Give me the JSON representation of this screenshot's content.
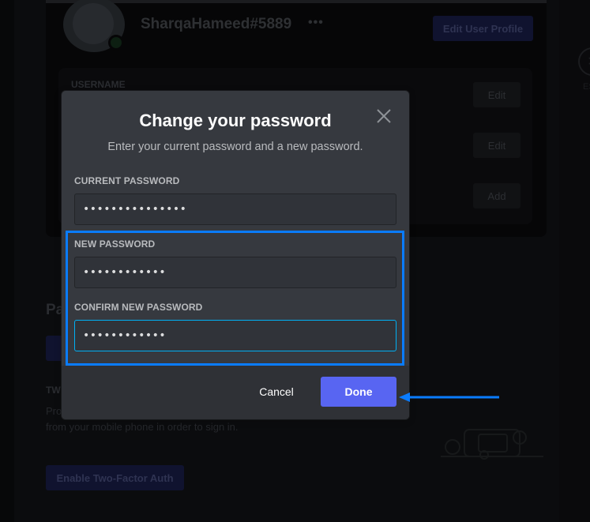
{
  "background": {
    "profile": {
      "username": "SharqaHameed#5889",
      "more_label": "•••",
      "edit_profile_label": "Edit User Profile"
    },
    "account_info": {
      "username_label": "USERNAME",
      "buttons": [
        "Edit",
        "Edit",
        "Add"
      ]
    },
    "close_button_label": "✕",
    "esc_label": "ESC",
    "password_section": {
      "heading": "Pa",
      "tfa_label": "TW",
      "tfa_text": "Pro                                                                                                         you'll be required to enter both your password and an authentication code from your mobile phone in order to sign in.",
      "tfa_button_label": "Enable Two-Factor Auth"
    }
  },
  "modal": {
    "title": "Change your password",
    "subtitle": "Enter your current password and a new password.",
    "fields": [
      {
        "label": "CURRENT PASSWORD",
        "value": "•••••••••••••••",
        "focused": false
      },
      {
        "label": "NEW PASSWORD",
        "value": "••••••••••••",
        "focused": false
      },
      {
        "label": "CONFIRM NEW PASSWORD",
        "value": "••••••••••••",
        "focused": true
      }
    ],
    "cancel_label": "Cancel",
    "done_label": "Done",
    "accent_color": "#5865f2"
  },
  "annotations": {
    "highlight_color": "#0a7cff",
    "highlight_target": "new password fields",
    "arrow_target": "Done button"
  }
}
